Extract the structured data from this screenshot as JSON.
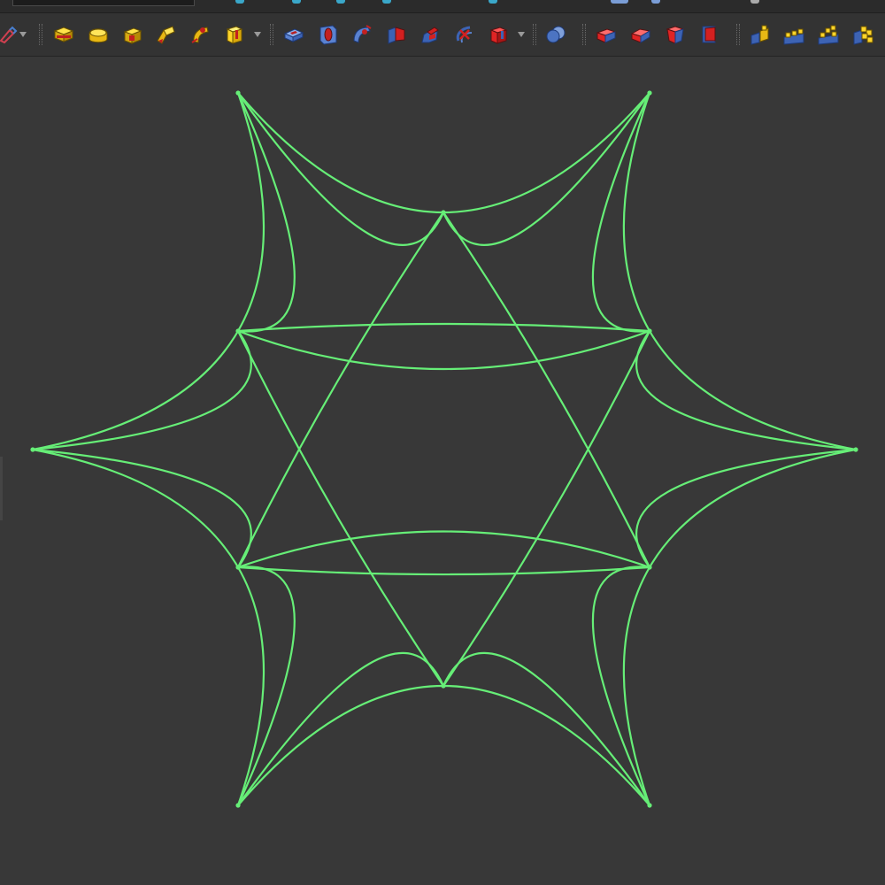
{
  "window": {
    "view": "sketch-viewport"
  },
  "colors": {
    "background": "#383838",
    "toolbar": "#333333",
    "curve": "#66ee77",
    "yellow": "#f2c81e",
    "red": "#d42020",
    "blue": "#3d6cc4"
  },
  "toolbar": {
    "buttons": [
      {
        "name": "sketch-tool-icon",
        "icon": "pen"
      },
      {
        "name": "extrude-icon",
        "icon": "yellow-box"
      },
      {
        "name": "revolve-icon",
        "icon": "yellow-round"
      },
      {
        "name": "mirror-icon",
        "icon": "yellow-corner"
      },
      {
        "name": "loft-icon",
        "icon": "yellow-loft"
      },
      {
        "name": "sweep-icon",
        "icon": "yellow-sweep"
      },
      {
        "name": "additive-primitive-icon",
        "icon": "yellow-cube"
      },
      {
        "name": "pocket-icon",
        "icon": "blue-pocket"
      },
      {
        "name": "hole-icon",
        "icon": "blue-hole"
      },
      {
        "name": "groove-icon",
        "icon": "blue-groove"
      },
      {
        "name": "subtractive-loft-icon",
        "icon": "red-loft"
      },
      {
        "name": "subtractive-pipe-icon",
        "icon": "red-pipe"
      },
      {
        "name": "subtractive-helix-icon",
        "icon": "red-helix"
      },
      {
        "name": "subtractive-primitive-icon",
        "icon": "red-cube"
      },
      {
        "name": "boolean-icon",
        "icon": "blue-spheres"
      },
      {
        "name": "fillet-icon",
        "icon": "red-fillet"
      },
      {
        "name": "chamfer-icon",
        "icon": "red-chamfer"
      },
      {
        "name": "draft-icon",
        "icon": "red-draft"
      },
      {
        "name": "thickness-icon",
        "icon": "red-thickness"
      },
      {
        "name": "mirrored-icon",
        "icon": "yellow-mirror"
      },
      {
        "name": "linear-pattern-icon",
        "icon": "yellow-linear"
      },
      {
        "name": "polar-pattern-icon",
        "icon": "yellow-polar"
      },
      {
        "name": "multitransform-icon",
        "icon": "yellow-multi"
      }
    ]
  },
  "sketch": {
    "description": "sketch-curves",
    "node_count": 12
  }
}
